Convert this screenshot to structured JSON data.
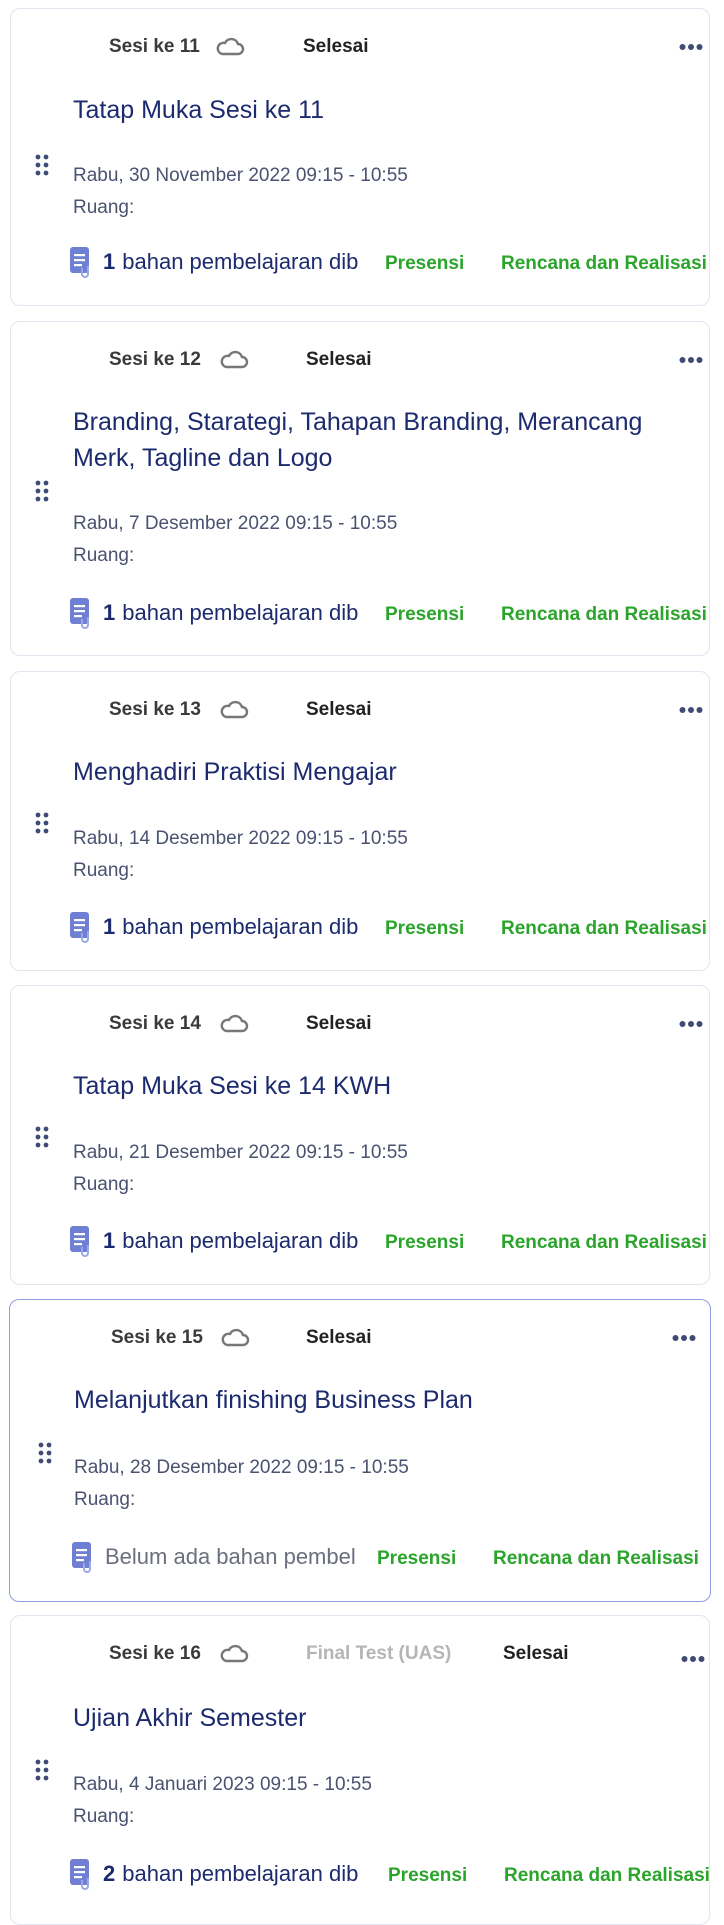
{
  "sessions": [
    {
      "sesi": "Sesi ke 11",
      "tag": "",
      "status": "Selesai",
      "title": "Tatap Muka Sesi ke 11",
      "date": "Rabu, 30 November 2022 09:15 - 10:55",
      "room": "Ruang:",
      "material_count": "1",
      "material_text": "bahan pembelajaran dib",
      "presensi": "Presensi",
      "rencana": "Rencana dan Realisasi"
    },
    {
      "sesi": "Sesi ke 12",
      "tag": "",
      "status": "Selesai",
      "title": "Branding, Starategi, Tahapan Branding, Merancang Merk, Tagline dan Logo",
      "date": "Rabu, 7 Desember 2022 09:15 - 10:55",
      "room": "Ruang:",
      "material_count": "1",
      "material_text": "bahan pembelajaran dib",
      "presensi": "Presensi",
      "rencana": "Rencana dan Realisasi"
    },
    {
      "sesi": "Sesi ke 13",
      "tag": "",
      "status": "Selesai",
      "title": "Menghadiri Praktisi Mengajar",
      "date": "Rabu, 14 Desember 2022 09:15 - 10:55",
      "room": "Ruang:",
      "material_count": "1",
      "material_text": "bahan pembelajaran dib",
      "presensi": "Presensi",
      "rencana": "Rencana dan Realisasi"
    },
    {
      "sesi": "Sesi ke 14",
      "tag": "",
      "status": "Selesai",
      "title": "Tatap Muka Sesi ke 14 KWH",
      "date": "Rabu, 21 Desember 2022 09:15 - 10:55",
      "room": "Ruang:",
      "material_count": "1",
      "material_text": "bahan pembelajaran dib",
      "presensi": "Presensi",
      "rencana": "Rencana dan Realisasi"
    },
    {
      "sesi": "Sesi ke 15",
      "tag": "",
      "status": "Selesai",
      "title": "Melanjutkan finishing Business Plan",
      "date": "Rabu, 28 Desember 2022 09:15 - 10:55",
      "room": "Ruang:",
      "material_count": "",
      "material_text": "Belum ada bahan pembel",
      "presensi": "Presensi",
      "rencana": "Rencana dan Realisasi"
    },
    {
      "sesi": "Sesi ke 16",
      "tag": "Final Test (UAS)",
      "status": "Selesai",
      "title": "Ujian Akhir Semester",
      "date": "Rabu, 4 Januari 2023 09:15 - 10:55",
      "room": "Ruang:",
      "material_count": "2",
      "material_text": "bahan pembelajaran dib",
      "presensi": "Presensi",
      "rencana": "Rencana dan Realisasi"
    }
  ],
  "colors": {
    "link_green": "#2aa42a",
    "title_blue": "#1c2a6e",
    "icon_purple": "#6f7fd4",
    "active_border": "#8f9ede"
  },
  "icons": {
    "drag": "drag-handle-icon",
    "cloud": "cloud-icon",
    "more": "more-horizontal-icon",
    "document": "document-attachment-icon"
  }
}
